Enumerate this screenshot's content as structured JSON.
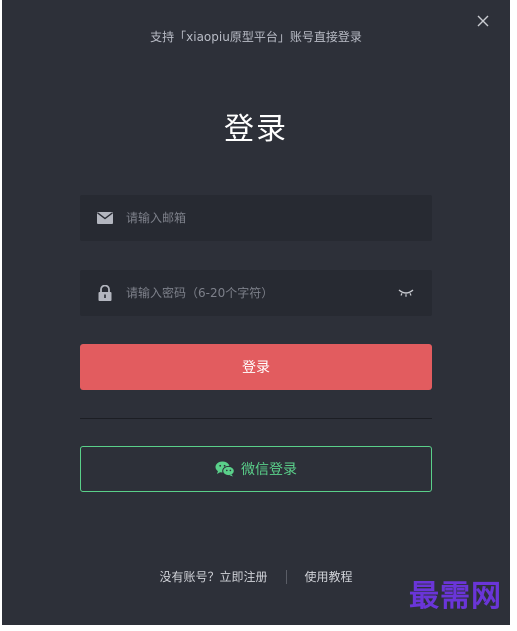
{
  "header": {
    "subtitle": "支持「xiaopiu原型平台」账号直接登录",
    "title": "登录",
    "close_icon": "close-icon"
  },
  "form": {
    "email": {
      "placeholder": "请输入邮箱",
      "value": "",
      "icon": "mail-icon"
    },
    "password": {
      "placeholder": "请输入密码（6-20个字符）",
      "value": "",
      "icon": "lock-icon",
      "toggle_icon": "eye-closed-icon"
    },
    "login_label": "登录",
    "wechat_label": "微信登录",
    "wechat_icon": "wechat-icon"
  },
  "footer": {
    "register_label": "没有账号？立即注册",
    "tutorial_label": "使用教程"
  },
  "watermark": "最需网",
  "colors": {
    "dialog_bg": "#2d3039",
    "field_bg": "#272a32",
    "primary": "#e25c5f",
    "wechat": "#5ad08a",
    "watermark": "#6a35d8"
  }
}
